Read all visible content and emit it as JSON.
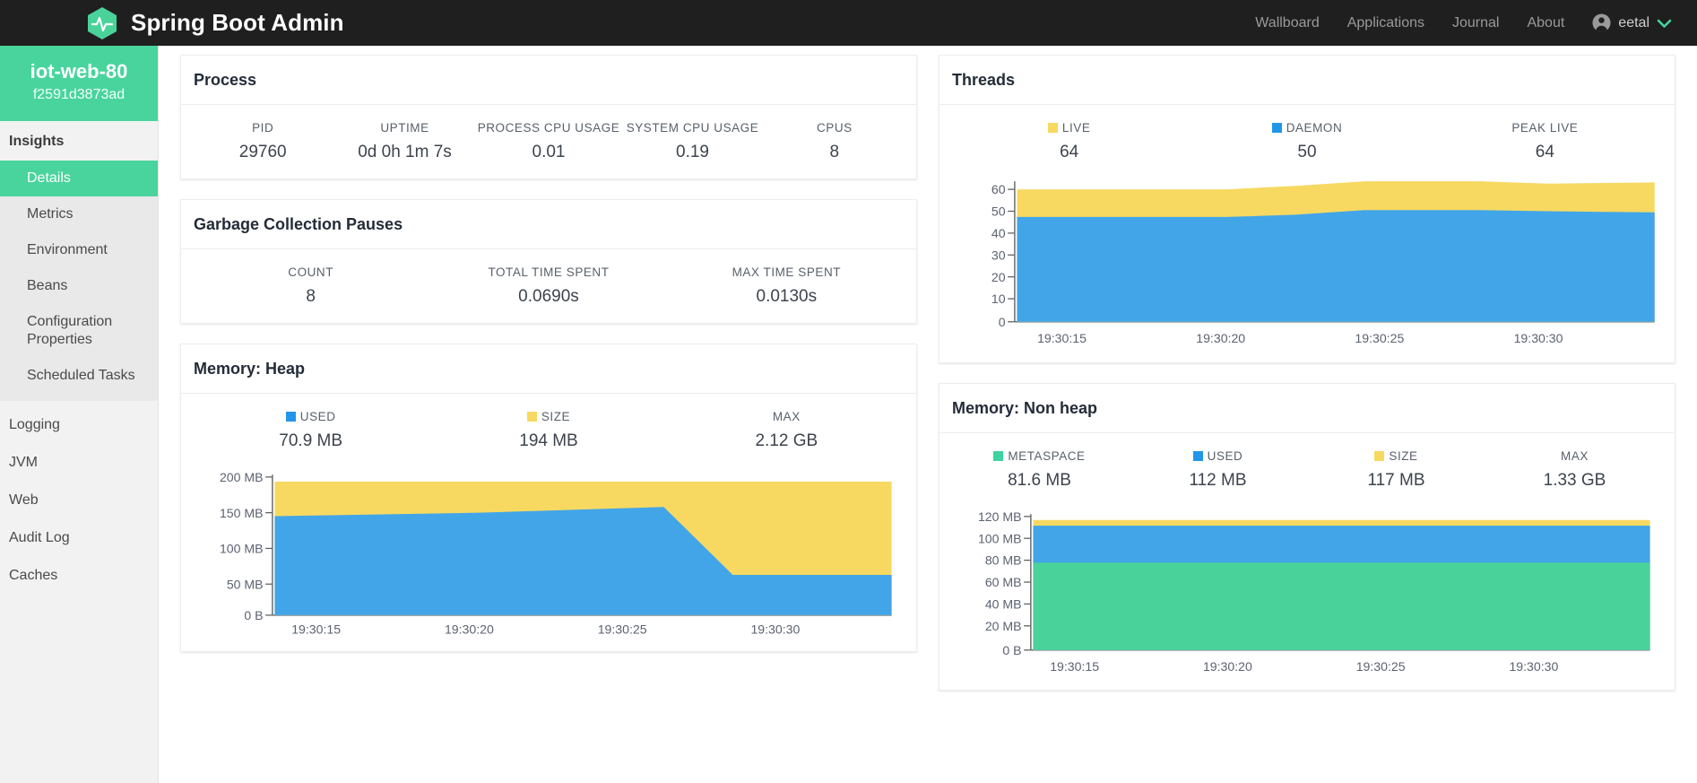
{
  "navbar": {
    "brand": "Spring Boot Admin",
    "logo_icon": "hexagon-pulse-icon",
    "links": [
      {
        "label": "Wallboard"
      },
      {
        "label": "Applications"
      },
      {
        "label": "Journal"
      },
      {
        "label": "About"
      }
    ],
    "user": {
      "name": "eetal",
      "avatar_icon": "user-circle-icon",
      "caret_icon": "chevron-down-icon"
    }
  },
  "sidebar": {
    "app_name": "iot-web-80",
    "instance_id": "f2591d3873ad",
    "group_label": "Insights",
    "insight_items": [
      {
        "label": "Details",
        "active": true
      },
      {
        "label": "Metrics",
        "active": false
      },
      {
        "label": "Environment",
        "active": false
      },
      {
        "label": "Beans",
        "active": false
      },
      {
        "label": "Configuration Properties",
        "active": false
      },
      {
        "label": "Scheduled Tasks",
        "active": false
      }
    ],
    "root_items": [
      {
        "label": "Logging"
      },
      {
        "label": "JVM"
      },
      {
        "label": "Web"
      },
      {
        "label": "Audit Log"
      },
      {
        "label": "Caches"
      }
    ]
  },
  "colors": {
    "accent_green": "#49d49d",
    "series_green": "#4ad29b",
    "series_blue": "#42a5e8",
    "series_yellow": "#f7d962",
    "header_dark": "#1f1f1f",
    "text_dark": "#232c38"
  },
  "cards": {
    "process": {
      "title": "Process",
      "stats": [
        {
          "label": "PID",
          "value": "29760"
        },
        {
          "label": "UPTIME",
          "value": "0d 0h 1m 7s"
        },
        {
          "label": "PROCESS CPU USAGE",
          "value": "0.01"
        },
        {
          "label": "SYSTEM CPU USAGE",
          "value": "0.19"
        },
        {
          "label": "CPUS",
          "value": "8"
        }
      ]
    },
    "gc": {
      "title": "Garbage Collection Pauses",
      "stats": [
        {
          "label": "COUNT",
          "value": "8"
        },
        {
          "label": "TOTAL TIME SPENT",
          "value": "0.0690s"
        },
        {
          "label": "MAX TIME SPENT",
          "value": "0.0130s"
        }
      ]
    },
    "threads": {
      "title": "Threads",
      "stats": [
        {
          "label": "LIVE",
          "value": "64",
          "color": "#f7d962"
        },
        {
          "label": "DAEMON",
          "value": "50",
          "color": "#2196e8"
        },
        {
          "label": "PEAK LIVE",
          "value": "64",
          "color": null
        }
      ]
    },
    "heap": {
      "title": "Memory: Heap",
      "stats": [
        {
          "label": "USED",
          "value": "70.9 MB",
          "color": "#2196e8"
        },
        {
          "label": "SIZE",
          "value": "194 MB",
          "color": "#f7d962"
        },
        {
          "label": "MAX",
          "value": "2.12 GB",
          "color": null
        }
      ]
    },
    "nonheap": {
      "title": "Memory: Non heap",
      "stats": [
        {
          "label": "METASPACE",
          "value": "81.6 MB",
          "color": "#3ed3a3"
        },
        {
          "label": "USED",
          "value": "112 MB",
          "color": "#2196e8"
        },
        {
          "label": "SIZE",
          "value": "117 MB",
          "color": "#f7d962"
        },
        {
          "label": "MAX",
          "value": "1.33 GB",
          "color": null
        }
      ]
    }
  },
  "chart_data": [
    {
      "id": "threads",
      "type": "area",
      "title": "Threads",
      "stacked": true,
      "xlabel": "",
      "ylabel": "",
      "x": [
        "19:30:15",
        "19:30:20",
        "19:30:25",
        "19:30:30"
      ],
      "xticklabels": [
        "19:30:15",
        "19:30:20",
        "19:30:25",
        "19:30:30"
      ],
      "yticklabels": [
        "0",
        "10",
        "20",
        "30",
        "40",
        "50",
        "60"
      ],
      "ylim": [
        0,
        66
      ],
      "grid": false,
      "legend_position": "top",
      "series": [
        {
          "name": "DAEMON",
          "color": "#42a5e8",
          "values": [
            47,
            47,
            47,
            50,
            50,
            50,
            49,
            50
          ]
        },
        {
          "name": "LIVE",
          "color": "#f7d962",
          "values": [
            60,
            60,
            60,
            64,
            64,
            64,
            63,
            64
          ]
        }
      ]
    },
    {
      "id": "heap",
      "type": "area",
      "title": "Memory: Heap",
      "stacked": true,
      "xlabel": "",
      "ylabel": "",
      "x": [
        "19:30:15",
        "19:30:20",
        "19:30:25",
        "19:30:30"
      ],
      "xticklabels": [
        "19:30:15",
        "19:30:20",
        "19:30:25",
        "19:30:30"
      ],
      "yticklabels": [
        "0 B",
        "50 MB",
        "100 MB",
        "150 MB",
        "200 MB"
      ],
      "ylim": [
        0,
        210
      ],
      "grid": false,
      "legend_position": "top",
      "series": [
        {
          "name": "USED",
          "color": "#42a5e8",
          "values": [
            140,
            143,
            146,
            150,
            71,
            71,
            71
          ]
        },
        {
          "name": "SIZE",
          "color": "#f7d962",
          "values": [
            194,
            194,
            194,
            194,
            194,
            194,
            194
          ]
        }
      ]
    },
    {
      "id": "nonheap",
      "type": "area",
      "title": "Memory: Non heap",
      "stacked": true,
      "xlabel": "",
      "ylabel": "",
      "x": [
        "19:30:15",
        "19:30:20",
        "19:30:25",
        "19:30:30"
      ],
      "xticklabels": [
        "19:30:15",
        "19:30:20",
        "19:30:25",
        "19:30:30"
      ],
      "yticklabels": [
        "0 B",
        "20 MB",
        "40 MB",
        "60 MB",
        "80 MB",
        "100 MB",
        "120 MB"
      ],
      "ylim": [
        0,
        126
      ],
      "grid": false,
      "legend_position": "top",
      "series": [
        {
          "name": "METASPACE",
          "color": "#4ad29b",
          "values": [
            81.6,
            81.6,
            81.6,
            81.6,
            81.6
          ]
        },
        {
          "name": "USED",
          "color": "#42a5e8",
          "values": [
            112,
            112,
            112,
            112,
            112
          ]
        },
        {
          "name": "SIZE",
          "color": "#f7d962",
          "values": [
            117,
            117,
            117,
            117,
            117
          ]
        }
      ]
    }
  ]
}
